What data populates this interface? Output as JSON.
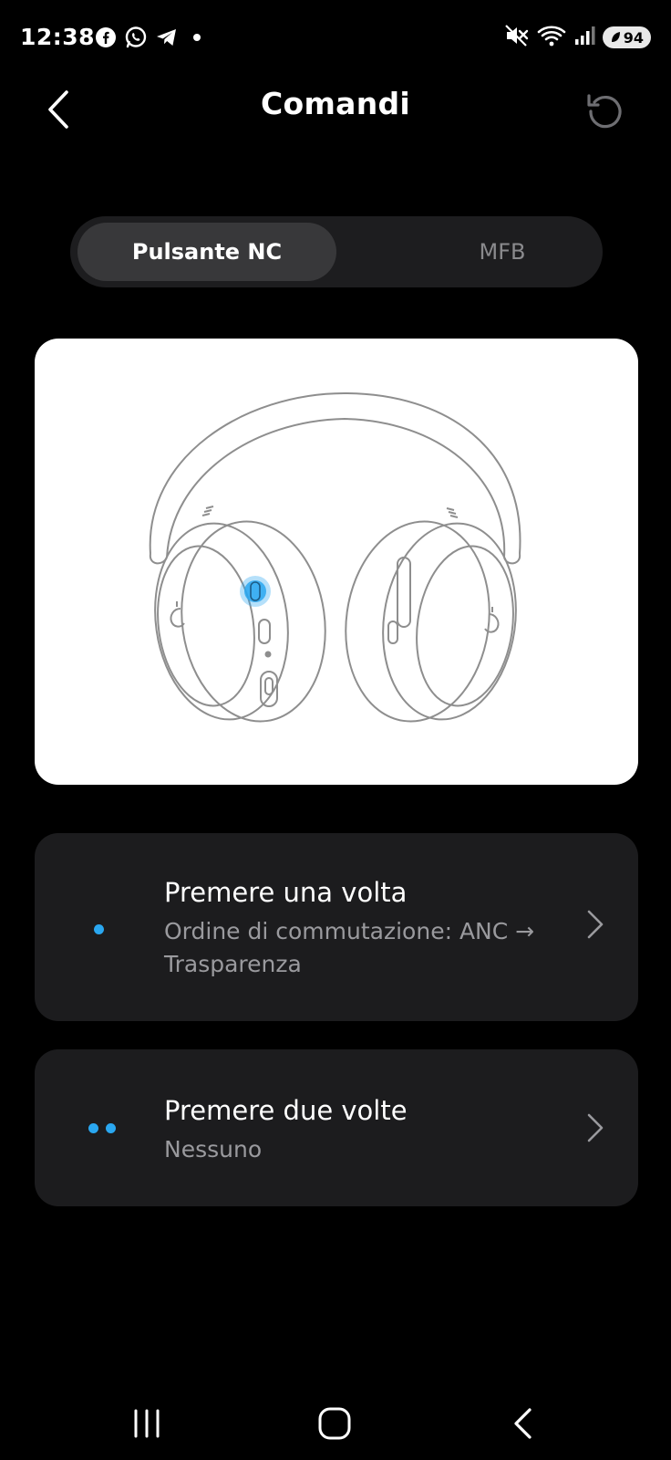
{
  "status_bar": {
    "time": "12:38",
    "notification_icons": [
      "facebook-icon",
      "whatsapp-icon",
      "telegram-icon"
    ],
    "system_icons": [
      "mute-icon",
      "wifi-icon",
      "signal-icon"
    ],
    "battery": "94"
  },
  "header": {
    "title": "Comandi",
    "back_icon": "chevron-left-icon",
    "reset_icon": "reset-icon"
  },
  "tabs": [
    {
      "label": "Pulsante NC",
      "selected": true
    },
    {
      "label": "MFB",
      "selected": false
    }
  ],
  "illustration": {
    "icon": "headphones-illustration",
    "highlight_color": "#2aa7f0"
  },
  "options": [
    {
      "title": "Premere una volta",
      "subtitle": "Ordine di commutazione: ANC → Trasparenza",
      "dots": 1
    },
    {
      "title": "Premere due volte",
      "subtitle": "Nessuno",
      "dots": 2
    }
  ],
  "colors": {
    "background": "#000000",
    "card": "#1c1c1e",
    "accent": "#2aa7f0"
  },
  "navbar": {
    "icons": [
      "recents-icon",
      "home-icon",
      "back-icon"
    ]
  }
}
